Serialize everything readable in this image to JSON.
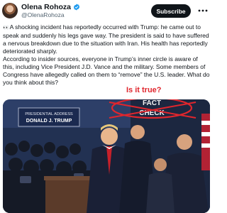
{
  "post": {
    "author_name": "Olena Rohoza",
    "author_handle": "@OlenaRohoza",
    "subscribe_label": "Subscribe",
    "more_icon": "more-dots-icon",
    "verified_icon": "verified-badge-icon",
    "paragraph_1": "A shocking incident has reportedly occurred with Trump: he came out to speak and suddenly his legs gave way. The president is said to have suffered a nervous breakdown due to the situation with Iran. His health has reportedly deteriorated sharply.",
    "paragraph_2": "According to insider sources, everyone in Trump’s inner circle is aware of this, including Vice President J.D. Vance and the military. Some members of Congress have allegedly called on them to “remove” the U.S. leader. What do you think about this?",
    "eyes_emoji": "👀"
  },
  "image": {
    "annotation": "Is it true?",
    "stamp_line_1": "FACT",
    "stamp_line_2": "CHECK",
    "banner_line_1": "PRESIDENTIAL ADDRESS",
    "banner_line_2": "DONALD J. TRUMP"
  },
  "colors": {
    "accent_red": "#e0262d",
    "verified_blue": "#1d9bf0",
    "button_dark": "#0f1419"
  }
}
